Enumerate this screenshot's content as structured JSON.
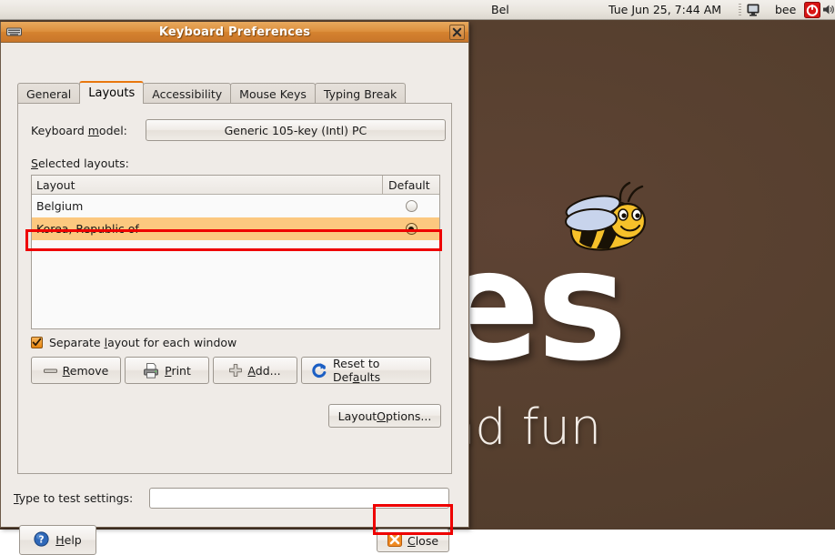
{
  "panel": {
    "layout_indicator": "Bel",
    "clock": "Tue Jun 25,  7:44 AM",
    "user": "bee",
    "icons": {
      "monitor": "monitor-icon",
      "power": "power-icon",
      "volume": "volume-icon",
      "grip": "panel-grip"
    }
  },
  "desktop": {
    "wallpaper_text_large": "es",
    "wallpaper_text_small": "nd fun",
    "background_color": "#57402f",
    "bee": "bee-graphic"
  },
  "window": {
    "title": "Keyboard Preferences",
    "titlebar_color": "#d4822f",
    "close_tooltip": "Close"
  },
  "tabs": [
    {
      "label": "General",
      "active": false
    },
    {
      "label": "Layouts",
      "active": true
    },
    {
      "label": "Accessibility",
      "active": false
    },
    {
      "label": "Mouse Keys",
      "active": false
    },
    {
      "label": "Typing Break",
      "active": false
    }
  ],
  "layouts_tab": {
    "keyboard_model_label": "Keyboard model:",
    "keyboard_model_label_pre": "Keyboard ",
    "keyboard_model_label_mnemonic": "m",
    "keyboard_model_label_post": "odel:",
    "keyboard_model_value": "Generic 105-key (Intl) PC",
    "selected_layouts_label": "Selected layouts:",
    "selected_layouts_mnemonic": "S",
    "selected_layouts_post": "elected layouts:",
    "columns": [
      "Layout",
      "Default"
    ],
    "rows": [
      {
        "name": "Belgium",
        "default": false,
        "selected": false
      },
      {
        "name": "Korea, Republic of",
        "default": true,
        "selected": true
      }
    ],
    "separate_layout_label_pre": "Separate ",
    "separate_layout_mnemonic": "l",
    "separate_layout_post": "ayout for each window",
    "separate_layout_checked": true,
    "buttons": {
      "remove_pre": "",
      "remove_mnemonic": "R",
      "remove_post": "emove",
      "print_pre": "",
      "print_mnemonic": "P",
      "print_post": "rint",
      "add_pre": "",
      "add_mnemonic": "A",
      "add_post": "dd...",
      "reset_pre": "Reset to Def",
      "reset_mnemonic": "a",
      "reset_post": "ults",
      "layout_options_pre": "Layout ",
      "layout_options_mnemonic": "O",
      "layout_options_post": "ptions..."
    },
    "icons": {
      "remove": "minus-icon",
      "print": "printer-icon",
      "add": "plus-icon",
      "reset": "refresh-icon"
    }
  },
  "footer": {
    "type_test_label_pre": "",
    "type_test_mnemonic": "T",
    "type_test_label_post": "ype to test settings:",
    "type_test_value": "",
    "help_pre": "",
    "help_mnemonic": "H",
    "help_post": "elp",
    "close_pre": "",
    "close_mnemonic": "C",
    "close_post": "lose",
    "icons": {
      "help": "help-icon",
      "close": "close-x-icon"
    }
  },
  "annotations": {
    "highlight_color": "#ee0000",
    "boxes": [
      "korea-republic-of-row",
      "close-button"
    ]
  }
}
